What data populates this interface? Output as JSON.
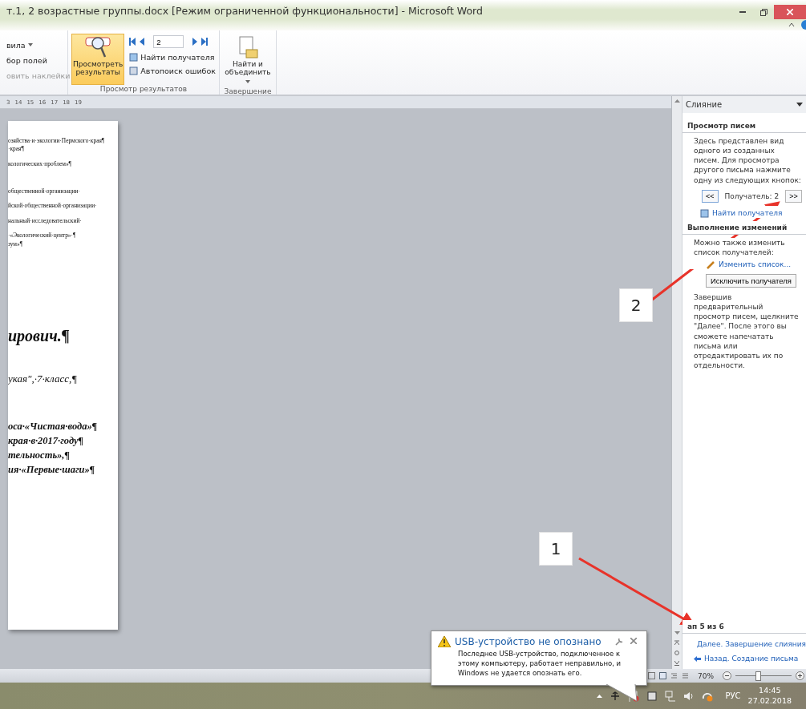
{
  "window": {
    "title": "т.1, 2 возрастные группы.docx [Режим ограниченной функциональности] - Microsoft Word"
  },
  "ribbon": {
    "rules_items": [
      {
        "label": "вила",
        "dropdown": true,
        "disabled": false
      },
      {
        "label": "бор полей",
        "dropdown": false,
        "disabled": false
      },
      {
        "label": "овить наклейки",
        "dropdown": false,
        "disabled": true
      }
    ],
    "preview_button": {
      "label": "Просмотреть результаты",
      "selected": true
    },
    "record_field": {
      "value": "2"
    },
    "preview_items": [
      {
        "label": "Найти получателя"
      },
      {
        "label": "Автопоиск ошибок"
      }
    ],
    "preview_group_label": "Просмотр результатов",
    "finish_button": {
      "label": "Найти и объединить",
      "dropdown": true
    },
    "finish_group_label": "Завершение"
  },
  "ruler": [
    "3",
    "14",
    "15",
    "16",
    "17",
    "18",
    "19"
  ],
  "document": {
    "blocks": [
      {
        "kind": "small",
        "lines": [
          "озяйства·и·экологии·Пермского·края¶",
          "·края¶"
        ]
      },
      {
        "kind": "small",
        "lines": [
          "кологических·проблем»¶"
        ]
      },
      {
        "kind": "small_gap",
        "lines": [
          "общественной·организации·"
        ]
      },
      {
        "kind": "small",
        "lines": [
          "йской·общественной·организации·"
        ]
      },
      {
        "kind": "small",
        "lines": [
          "нальный·исследовательский·"
        ]
      },
      {
        "kind": "small",
        "lines": [
          "·«Экологический·центр»·¶",
          "зум»¶"
        ]
      },
      {
        "kind": "heading",
        "lines": [
          "ирович.¶"
        ]
      },
      {
        "kind": "italic",
        "lines": [
          "укая\",·7·класс,¶"
        ]
      },
      {
        "kind": "bold_italic",
        "lines": [
          "оса·«Чистая·вода»¶",
          "края·в·2017·году¶",
          "тельность»,¶",
          "ия·«Первые·шаги»¶"
        ]
      }
    ]
  },
  "task_pane": {
    "title": "Слияние",
    "preview_heading": "Просмотр писем",
    "preview_text": "Здесь представлен вид одного из созданных писем. Для просмотра другого письма нажмите одну из следующих кнопок:",
    "prev_button": "<<",
    "recipient": "Получатель: 2",
    "next_button": ">>",
    "find_link": "Найти получателя",
    "changes_heading": "Выполнение изменений",
    "changes_text": "Можно также изменить список получателей:",
    "edit_link": "Изменить список...",
    "exclude_button": "Исключить получателя",
    "finish_text": "Завершив предварительный просмотр писем, щелкните \"Далее\". После этого вы сможете напечатать письма или отредактировать их по отдельности.",
    "step": "ап 5 из 6",
    "next_link": "Далее. Завершение слияния",
    "back_link": "Назад. Создание письма"
  },
  "status_bar": {
    "zoom": "70%",
    "zoom_slider": {
      "level": 0.4
    }
  },
  "taskbar": {
    "language": "РУС",
    "time": "14:45",
    "date": "27.02.2018"
  },
  "notification": {
    "title": "USB-устройство не опознано",
    "text": "Последнее USB-устройство, подключенное к этому компьютеру, работает неправильно, и Windows не удается опознать его."
  },
  "callouts": [
    {
      "label": "1"
    },
    {
      "label": "2"
    }
  ]
}
